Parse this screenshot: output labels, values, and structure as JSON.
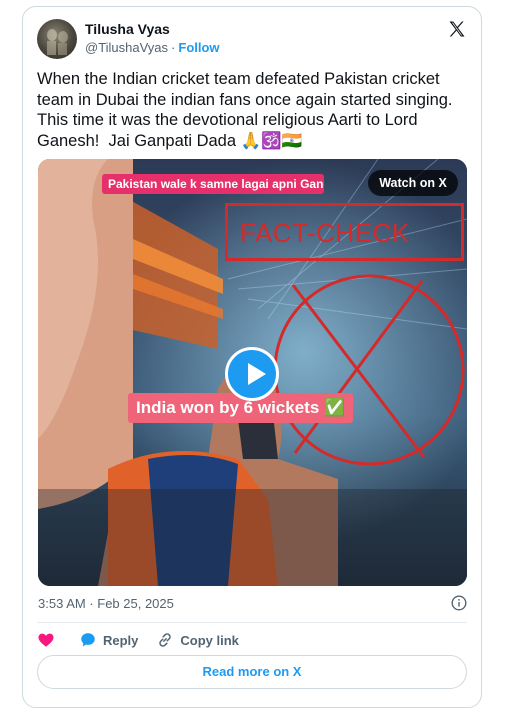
{
  "user": {
    "display_name": "Tilusha Vyas",
    "handle": "@TilushaVyas",
    "separator": "·",
    "follow_label": "Follow"
  },
  "tweet": {
    "text": "When the Indian cricket team defeated Pakistan cricket team in Dubai the indian fans once again started singing. This time it was the devotional religious Aarti to Lord Ganesh!  Jai Ganpati Dada 🙏🕉️🇮🇳",
    "timestamp": "3:53 AM · Feb 25, 2025"
  },
  "media": {
    "caption_top": "Pakistan wale k samne lagai apni Ganesh aarti",
    "watch_label": "Watch on X",
    "fact_check_label": "FACT-CHECK",
    "caption_middle": "India won by 6 wickets ✅",
    "overlay_color": "#d42a2a"
  },
  "actions": {
    "like_label": "",
    "reply_label": "Reply",
    "copy_link_label": "Copy link"
  },
  "footer": {
    "read_more_label": "Read more on X"
  },
  "colors": {
    "accent": "#1d9bf0",
    "like": "#f91880",
    "text_secondary": "#536471"
  }
}
